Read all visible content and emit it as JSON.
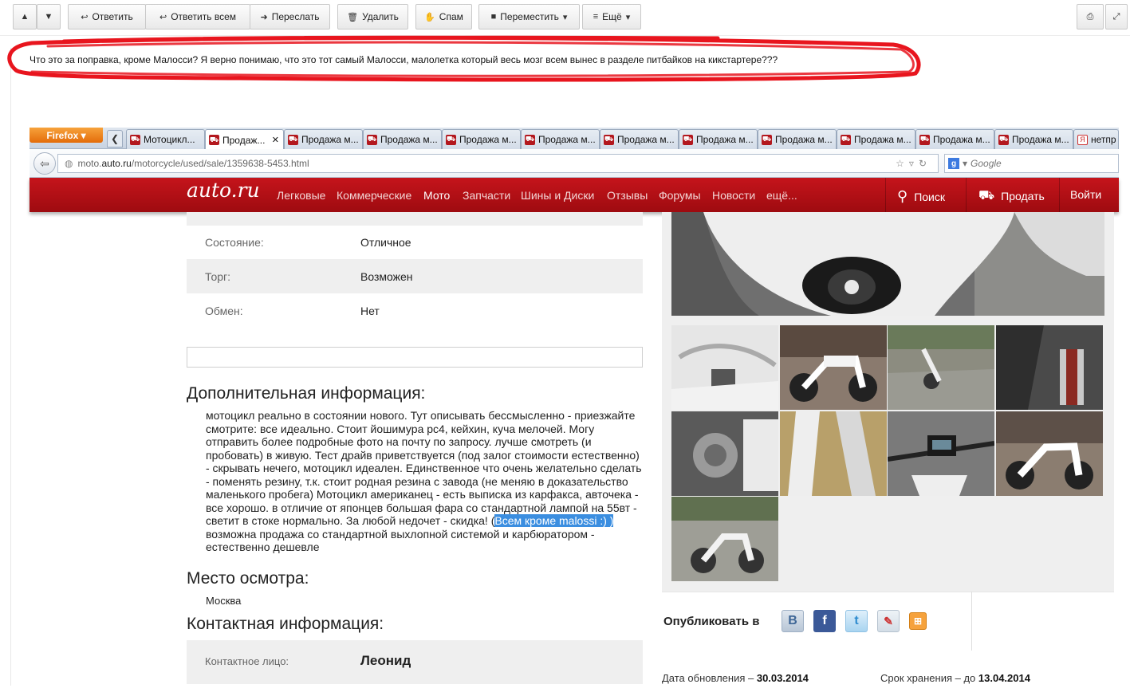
{
  "mail_toolbar": {
    "up_icon": "up-arrow-icon",
    "down_icon": "down-arrow-icon",
    "reply": "Ответить",
    "reply_all": "Ответить всем",
    "forward": "Переслать",
    "delete": "Удалить",
    "spam": "Спам",
    "move": "Переместить",
    "more": "Ещё"
  },
  "comment": "Что это за поправка, кроме Малосси? Я верно понимаю, что это тот самый Малосси, малолетка который весь мозг всем вынес в разделе питбайков на кикстартере???",
  "browser": {
    "firefox_button": "Firefox",
    "tabs": [
      "Мотоцикл...",
      "Продаж...",
      "Продажа м...",
      "Продажа м...",
      "Продажа м...",
      "Продажа м...",
      "Продажа м...",
      "Продажа м...",
      "Продажа м...",
      "Продажа м...",
      "Продажа м...",
      "Продажа м...",
      "нетпр"
    ],
    "url_prefix": "moto.",
    "url_domain": "auto.ru",
    "url_path": "/motorcycle/used/sale/1359638-5453.html",
    "search_placeholder": "Google"
  },
  "site": {
    "logo": "auto.ru",
    "nav": [
      "Легковые",
      "Коммерческие",
      "Мото",
      "Запчасти",
      "Шины и Диски",
      "Отзывы",
      "Форумы",
      "Новости",
      "ещё..."
    ],
    "search": "Поиск",
    "sell": "Продать",
    "login": "Войти"
  },
  "listing": {
    "condition_label": "Состояние:",
    "condition_value": "Отличное",
    "bargain_label": "Торг:",
    "bargain_value": "Возможен",
    "exchange_label": "Обмен:",
    "exchange_value": "Нет",
    "extra_heading": "Дополнительная информация:",
    "description_before": "мотоцикл реально в состоянии нового. Тут описывать бессмысленно - приезжайте смотрите: все идеально. Стоит йошимура pc4, кейхин, куча мелочей. Могу отправить более подробные фото на почту по запросу. лучше смотреть (и пробовать) в живую. Тест драйв приветствуется (под залог стоимости естественно) - скрывать нечего, мотоцикл идеален. Единственное что очень желательно сделать - поменять резину, т.к. стоит родная резина с завода (не меняю в доказательство маленького пробега) Мотоцикл американец - есть выписка из карфакса, авточека - все хорошо. в отличие от японцев большая фара со стандартной лампой на 55вт - светит в стоке нормально. За любой недочет - скидка! (",
    "description_highlight": "Всем кроме malossi :) )",
    "description_after": " возможна продажа со стандартной выхлопной системой и карбюратором - естественно дешевле",
    "place_heading": "Место осмотра:",
    "place_value": "Москва",
    "contact_heading": "Контактная информация:",
    "contact_label": "Контактное лицо:",
    "contact_value": "Леонид"
  },
  "sidebar": {
    "publish_label": "Опубликовать в",
    "social_icons": [
      "vk-icon",
      "facebook-icon",
      "twitter-icon",
      "livejournal-icon",
      "odnoklassniki-icon"
    ],
    "updated_label": "Дата обновления – ",
    "updated_value": "30.03.2014",
    "expires_label": "Срок хранения – до ",
    "expires_value": "13.04.2014"
  },
  "colors": {
    "brand_red": "#b3141a",
    "scribble_red": "#e8151e",
    "highlight_blue": "#3b8ee0"
  }
}
